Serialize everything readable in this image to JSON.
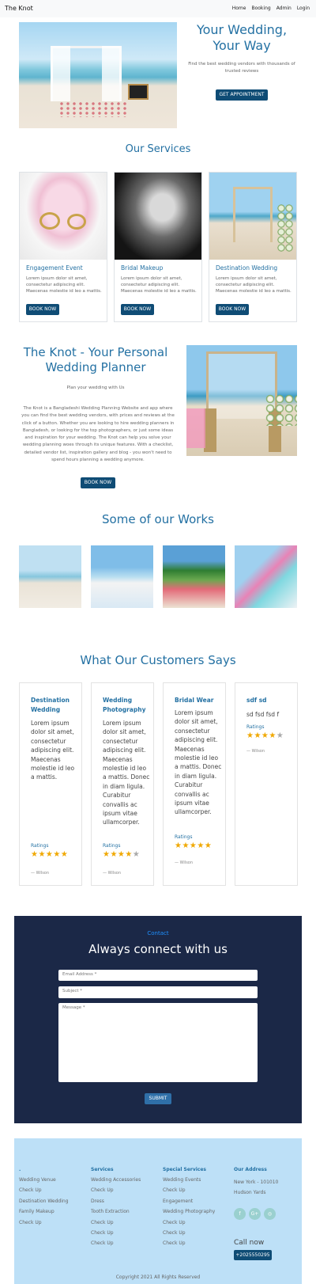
{
  "nav": {
    "brand": "The Knot",
    "links": [
      "Home",
      "Booking",
      "Admin",
      "Login"
    ]
  },
  "hero": {
    "title": "Your Wedding, Your Way",
    "subtitle": "Find the best wedding vendors with thousands of trusted reviews",
    "button": "GET APPOINTMENT"
  },
  "services": {
    "title": "Our Services",
    "items": [
      {
        "title": "Engagement Event",
        "text": "Lorem ipsum dolor sit amet, consectetur adipiscing elit. Maecenas molestie id leo a mattis.",
        "button": "BOOK NOW"
      },
      {
        "title": "Bridal Makeup",
        "text": "Lorem ipsum dolor sit amet, consectetur adipiscing elit. Maecenas molestie id leo a mattis.",
        "button": "BOOK NOW"
      },
      {
        "title": "Destination Wedding",
        "text": "Lorem ipsum dolor sit amet, consectetur adipiscing elit. Maecenas molestie id leo a mattis.",
        "button": "BOOK NOW"
      }
    ]
  },
  "about": {
    "title": "The Knot - Your Personal Wedding Planner",
    "tagline": "Plan your wedding with Us",
    "body": "The Knot is a Bangladeshi Wedding Planning Website and app where you can find the best wedding vendors, with prices and reviews at the click of a button. Whether you are looking to hire wedding planners in Bangladesh, or looking for the top photographers, or just some ideas and inspiration for your wedding. The Knot can help you solve your wedding planning woes through its unique features. With a checklist, detailed vendor list, inspiration gallery and blog - you won't need to spend hours planning a wedding anymore.",
    "button": "BOOK NOW"
  },
  "works": {
    "title": "Some of our Works"
  },
  "reviews": {
    "title": "What Our Customers Says",
    "items": [
      {
        "title": "Destination Wedding",
        "body": "Lorem ipsum dolor sit amet, consectetur adipiscing elit. Maecenas molestie id leo a mattis.",
        "ratings_label": "Ratings",
        "stars": 5,
        "author": "— Wilson"
      },
      {
        "title": "Wedding Photography",
        "body": "Lorem ipsum dolor sit amet, consectetur adipiscing elit. Maecenas molestie id leo a mattis. Donec in diam ligula. Curabitur convallis ac ipsum vitae ullamcorper.",
        "ratings_label": "Ratings",
        "stars": 4,
        "author": "— Wilson"
      },
      {
        "title": "Bridal Wear",
        "body": "Lorem ipsum dolor sit amet, consectetur adipiscing elit. Maecenas molestie id leo a mattis. Donec in diam ligula. Curabitur convallis ac ipsum vitae ullamcorper.",
        "ratings_label": "Ratings",
        "stars": 5,
        "author": "— Wilson"
      },
      {
        "title": "sdf sd",
        "body": "sd fsd fsd f",
        "ratings_label": "Ratings",
        "stars": 4,
        "author": "— Wilson"
      }
    ]
  },
  "contact": {
    "label": "Contact",
    "title": "Always connect with us",
    "email_placeholder": "Email Address *",
    "subject_placeholder": "Subject *",
    "message_placeholder": "Message *",
    "submit": "SUBMIT"
  },
  "footer": {
    "col1": {
      "heading": ".",
      "items": [
        "Wedding Venue",
        "Check Up",
        "Destination Wedding",
        "Family Makeup",
        "Check Up"
      ]
    },
    "col2": {
      "heading": "Services",
      "items": [
        "Wedding Accessories",
        "Check Up",
        "Dress",
        "Tooth Extraction",
        "Check Up",
        "Check Up",
        "Check Up"
      ]
    },
    "col3": {
      "heading": "Special Services",
      "items": [
        "Wedding Events",
        "Check Up",
        "Engagement",
        "Wedding Photography",
        "Check Up",
        "Check Up",
        "Check Up"
      ]
    },
    "col4": {
      "heading": "Our Address",
      "address": "New York - 101010 Hudson Yards"
    },
    "socials": [
      "f",
      "G+",
      "◎"
    ],
    "call_label": "Call now",
    "phone": "+2025550295",
    "copyright": "Copyright 2021 All Rights Reserved"
  }
}
